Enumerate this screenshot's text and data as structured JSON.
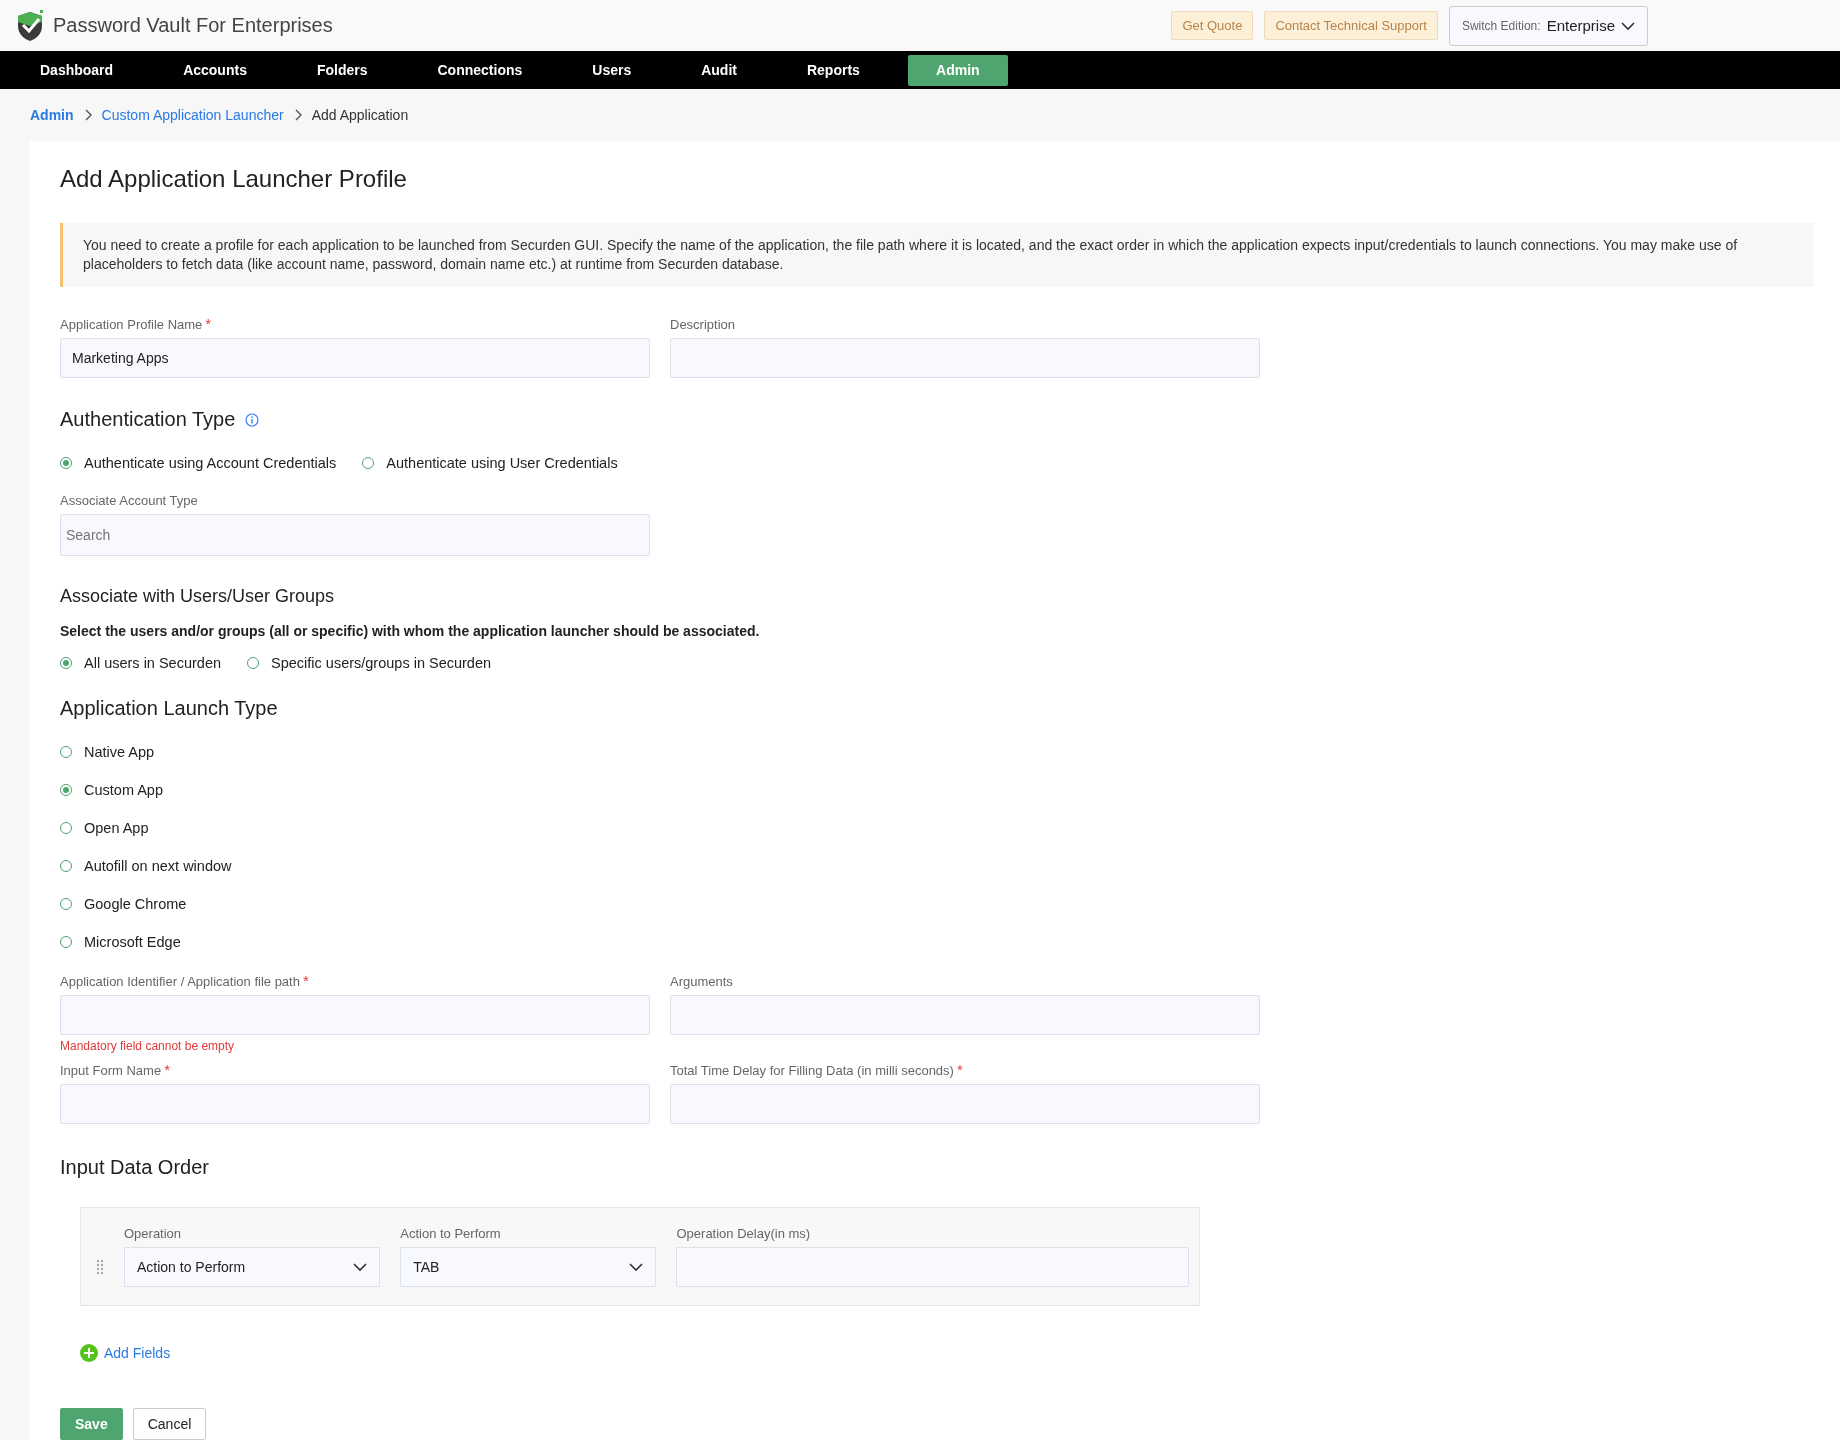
{
  "app": {
    "title": "Password Vault For Enterprises"
  },
  "header_buttons": [
    {
      "label": "Get Quote"
    },
    {
      "label": "Contact Technical Support"
    }
  ],
  "edition": {
    "label": "Switch Edition:",
    "value": "Enterprise"
  },
  "nav": [
    {
      "label": "Dashboard",
      "selected": false
    },
    {
      "label": "Accounts",
      "selected": false
    },
    {
      "label": "Folders",
      "selected": false
    },
    {
      "label": "Connections",
      "selected": false
    },
    {
      "label": "Users",
      "selected": false
    },
    {
      "label": "Audit",
      "selected": false
    },
    {
      "label": "Reports",
      "selected": false
    },
    {
      "label": "Admin",
      "selected": true
    }
  ],
  "breadcrumb": [
    {
      "label": "Admin",
      "kind": "link"
    },
    {
      "label": "Custom Application Launcher",
      "kind": "link"
    },
    {
      "label": "Add Application",
      "kind": "current"
    }
  ],
  "page_title": "Add Application Launcher Profile",
  "info": "You need to create a profile for each application to be launched from Securden GUI. Specify the name of the application, the file path where it is located, and the exact order in which the application expects input/credentials to launch connections. You may make use of placeholders to fetch data (like account name, password, domain name etc.) at runtime from Securden database.",
  "profile_name": {
    "label": "Application Profile Name",
    "required_mark": "*",
    "value": "Marketing Apps"
  },
  "description": {
    "label": "Description"
  },
  "auth_type": {
    "heading": "Authentication Type",
    "options": [
      {
        "label": "Authenticate using Account Credentials",
        "selected": true
      },
      {
        "label": "Authenticate using User Credentials",
        "selected": false
      }
    ]
  },
  "account_type": {
    "label": "Associate Account Type",
    "placeholder": "Search"
  },
  "associate": {
    "heading": "Associate with Users/User Groups",
    "text": "Select the users and/or groups (all or specific) with whom the application launcher should be associated.",
    "options": [
      {
        "label": "All users in Securden",
        "selected": true
      },
      {
        "label": "Specific users/groups in Securden",
        "selected": false
      }
    ]
  },
  "launch_type": {
    "heading": "Application Launch Type",
    "options": [
      {
        "label": "Native App",
        "selected": false
      },
      {
        "label": "Custom App",
        "selected": true
      },
      {
        "label": "Open App",
        "selected": false
      },
      {
        "label": "Autofill on next window",
        "selected": false
      },
      {
        "label": "Google Chrome",
        "selected": false
      },
      {
        "label": "Microsoft Edge",
        "selected": false
      }
    ]
  },
  "file_path": {
    "label": "Application Identifier / Application file path",
    "required_mark": "*",
    "error": "Mandatory field cannot be empty"
  },
  "arguments": {
    "label": "Arguments"
  },
  "input_form": {
    "label": "Input Form Name",
    "required_mark": "*"
  },
  "time_delay": {
    "label": "Total Time Delay for Filling Data (in milli seconds)",
    "required_mark": "*"
  },
  "input_data_order": {
    "heading": "Input Data Order",
    "rows": [
      {
        "operation_label": "Operation",
        "operation": "Action to Perform",
        "action_label": "Action to Perform",
        "action": "TAB",
        "delay_label": "Operation Delay(in ms)"
      }
    ]
  },
  "add_fields": "Add Fields",
  "buttons": [
    {
      "label": "Save",
      "kind": "primary"
    },
    {
      "label": "Cancel",
      "kind": "secondary"
    }
  ]
}
